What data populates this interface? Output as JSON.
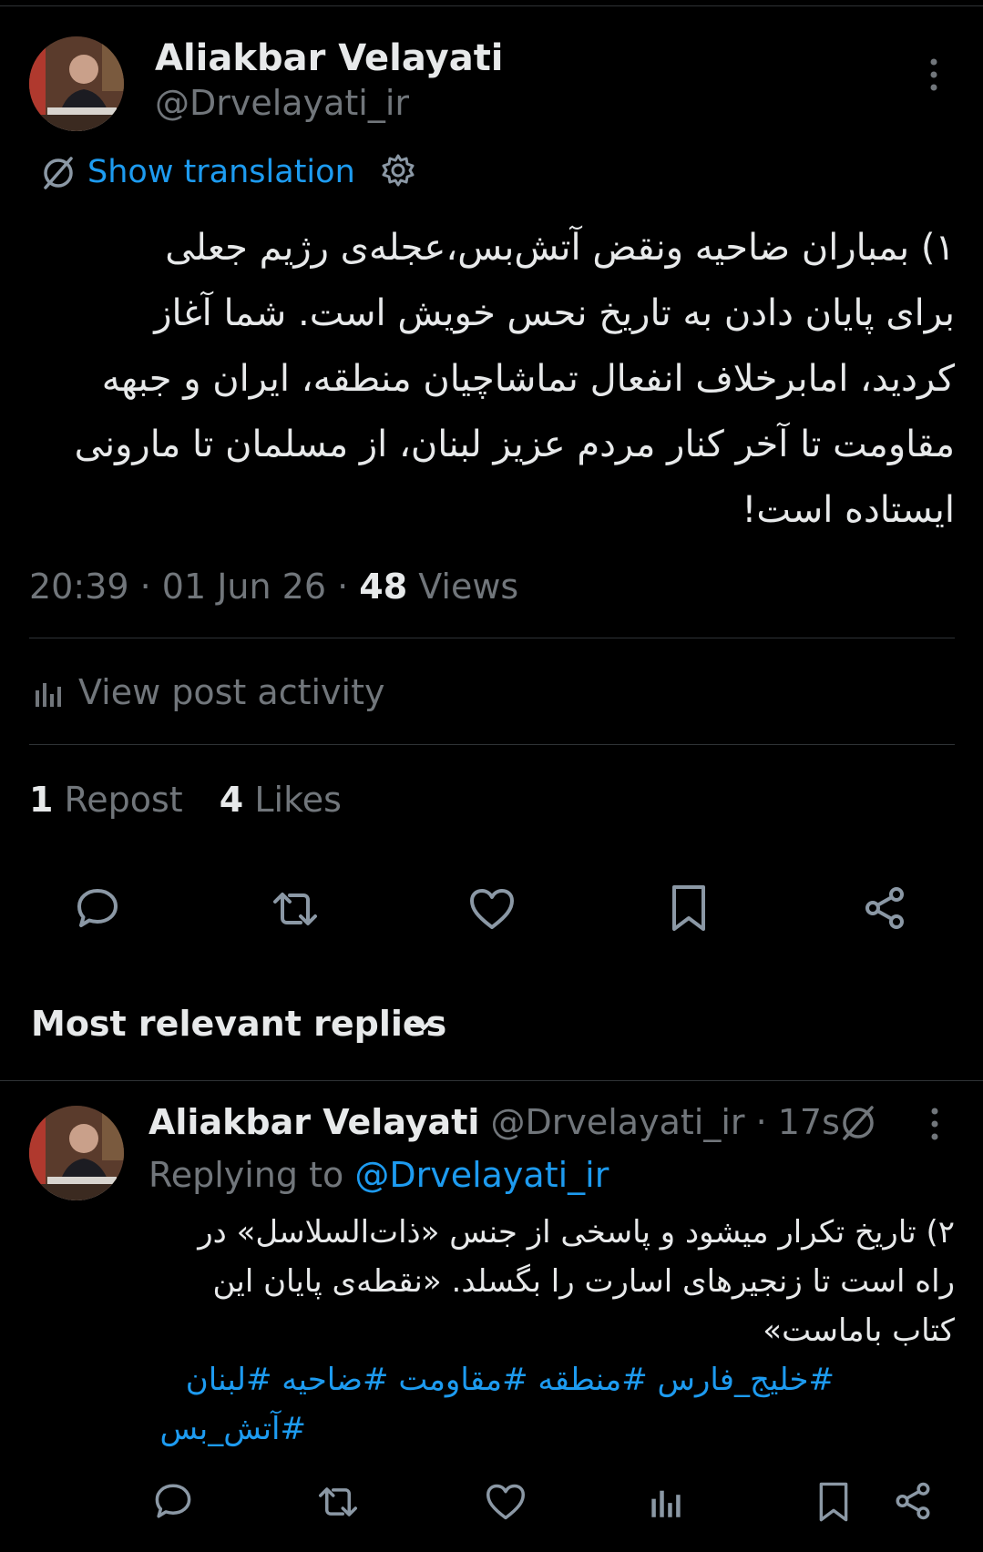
{
  "post": {
    "author_name": "Aliakbar Velayati",
    "author_handle": "@Drvelayati_ir",
    "show_translation": "Show translation",
    "body_lines": [
      "۱) بمباران ضاحیه ونقض آتش‌بس،عجله‌ی رژیم جعلی",
      "برای پایان دادن به تاریخ نحس خویش است. شما آغاز",
      "کردید، امابرخلاف انفعال تماشاچیان منطقه، ایران و جبهه",
      "مقاومت تا آخر کنار مردم عزیز لبنان، از مسلمان تا مارونی",
      "ایستاده است!"
    ],
    "time": "20:39",
    "date": "01 Jun 26",
    "views_count": "48",
    "views_label": "Views",
    "view_activity": "View post activity",
    "repost_count": "1",
    "repost_label": "Repost",
    "likes_count": "4",
    "likes_label": "Likes"
  },
  "replies_header": "Most relevant replies",
  "reply": {
    "author_name": "Aliakbar Velayati",
    "handle_time": "@Drvelayati_ir · 17s",
    "replying_prefix": "Replying to",
    "replying_handle": "@Drvelayati_ir",
    "body_lines": [
      "۲) تاریخ تکرار میشود و پاسخی از جنس «ذات‌السلاسل» در",
      "راه است تا زنجیرهای اسارت را بگسلد. «نقطه‌ی پایان این",
      "کتاب باماست»"
    ],
    "hashtags_line1": "#خلیج_فارس #منطقه #مقاومت #ضاحیه #لبنان",
    "hashtags_line2": "#آتش_بس"
  },
  "colors": {
    "background": "#000000",
    "text": "#e7e9ea",
    "muted": "#71767b",
    "accent": "#1d9bf0",
    "divider": "#2f3336"
  },
  "icons": [
    "more-icon",
    "translate-icon",
    "settings-icon",
    "analytics-icon",
    "reply-icon",
    "repost-icon",
    "like-icon",
    "bookmark-icon",
    "share-icon",
    "chevron-down-icon"
  ]
}
